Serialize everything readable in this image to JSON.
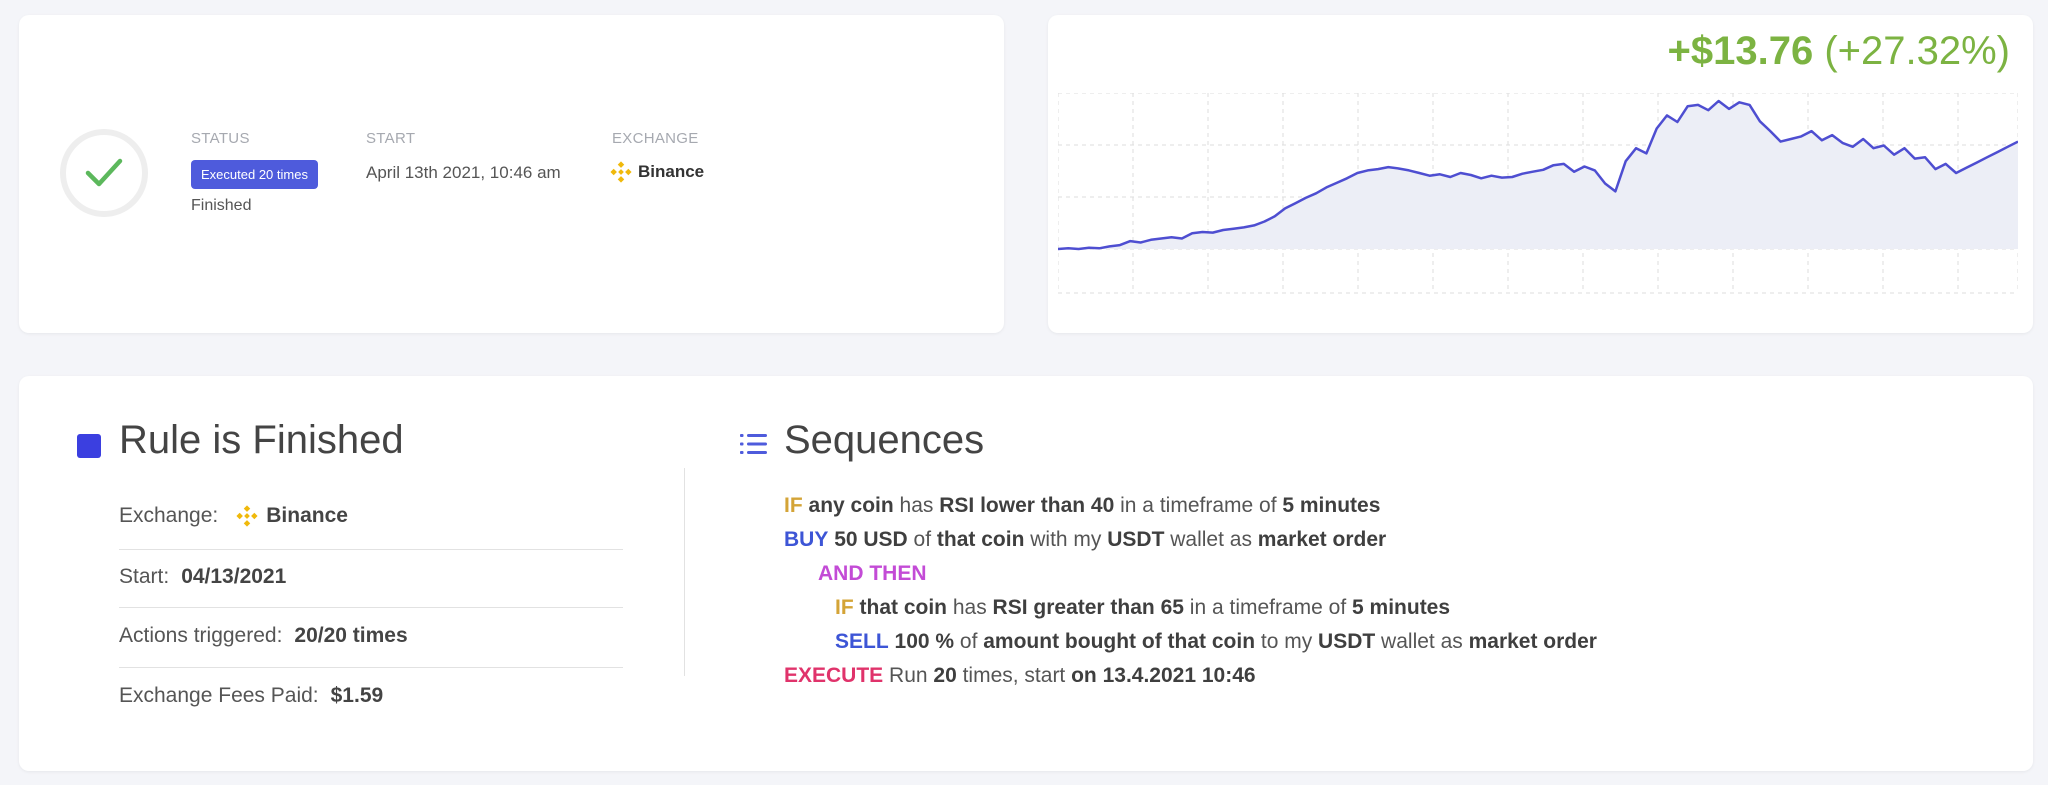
{
  "status_card": {
    "status_label": "STATUS",
    "status_badge": "Executed 20 times",
    "status_text": "Finished",
    "start_label": "START",
    "start_value": "April 13th 2021, 10:46 am",
    "exchange_label": "EXCHANGE",
    "exchange_value": "Binance",
    "status_icon": "check-icon",
    "accent_color": "#4e5bdc",
    "check_color": "#5cb85c"
  },
  "profit": {
    "absolute": "+$13.76",
    "percent": "(+27.32%)",
    "color": "#7cb342"
  },
  "chart_data": {
    "type": "area",
    "line_color": "#4e4ed1",
    "grid": true,
    "values": [
      10.0,
      10.1,
      10.0,
      10.2,
      10.1,
      10.4,
      10.6,
      11.2,
      11.0,
      11.4,
      11.6,
      11.8,
      11.6,
      12.4,
      12.6,
      12.5,
      12.9,
      13.1,
      13.3,
      13.6,
      14.2,
      15.0,
      16.2,
      17.0,
      17.8,
      18.5,
      19.4,
      20.1,
      20.8,
      21.6,
      22.0,
      22.2,
      22.5,
      22.3,
      22.0,
      21.6,
      21.2,
      21.4,
      21.0,
      21.6,
      21.3,
      20.8,
      21.2,
      20.9,
      21.0,
      21.5,
      21.8,
      22.1,
      22.8,
      23.0,
      21.8,
      22.6,
      22.0,
      20.0,
      18.8,
      23.4,
      25.4,
      24.6,
      28.4,
      30.4,
      29.4,
      31.8,
      32.0,
      31.2,
      32.6,
      31.4,
      32.4,
      32.0,
      29.5,
      28.0,
      26.4,
      26.8,
      27.2,
      28.0,
      26.6,
      27.4,
      26.2,
      25.6,
      26.8,
      25.4,
      25.8,
      24.4,
      25.4,
      23.8,
      24.0,
      22.2,
      23.0,
      21.6,
      22.4,
      23.2,
      24.0,
      24.8,
      25.6,
      26.4
    ]
  },
  "rule": {
    "title": "Rule is Finished",
    "exchange_label": "Exchange:",
    "exchange_value": "Binance",
    "start_label": "Start:",
    "start_value": "04/13/2021",
    "actions_label": "Actions triggered:",
    "actions_value": "20/20 times",
    "fees_label": "Exchange Fees Paid:",
    "fees_value": "$1.59",
    "square_color": "#3b3fe0"
  },
  "sequences": {
    "title": "Sequences",
    "icon": "list-icon",
    "line1": {
      "kw": "IF",
      "a": "any coin",
      "b": " has ",
      "c": "RSI lower than 40",
      "d": " in a timeframe of ",
      "e": "5 minutes"
    },
    "line2": {
      "kw": "BUY",
      "a": "50 USD",
      "b": " of ",
      "c": "that coin",
      "d": " with my ",
      "e": "USDT",
      "f": " wallet as ",
      "g": "market order"
    },
    "line3": {
      "kw": "AND THEN"
    },
    "line4": {
      "kw": "IF",
      "a": "that coin",
      "b": " has ",
      "c": "RSI greater than 65",
      "d": " in a timeframe of ",
      "e": "5 minutes"
    },
    "line5": {
      "kw": "SELL",
      "a": "100 %",
      "b": " of ",
      "c": "amount bought of that coin",
      "d": " to my ",
      "e": "USDT",
      "f": " wallet as ",
      "g": "market order"
    },
    "line6": {
      "kw": "EXECUTE",
      "a": " Run ",
      "b": "20",
      "c": " times, start ",
      "d": "on 13.4.2021 10:46"
    },
    "colors": {
      "if": "#d4a437",
      "buy": "#3d55d6",
      "then": "#c34bd6",
      "execute": "#e0336b"
    }
  }
}
